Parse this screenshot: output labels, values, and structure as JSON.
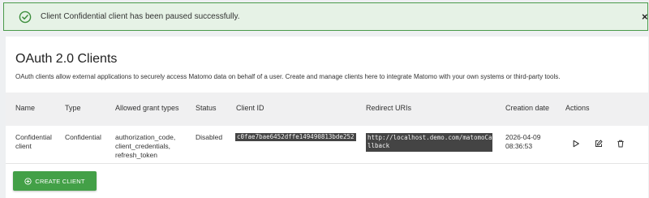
{
  "notice": {
    "message": "Client Confidential client has been paused successfully.",
    "close_glyph": "×",
    "icon": "check-circle-icon"
  },
  "card": {
    "title": "OAuth 2.0 Clients",
    "description": "OAuth clients allow external applications to securely access Matomo data on behalf of a user. Create and manage clients here to integrate Matomo with your own systems or third-party tools."
  },
  "table": {
    "headers": [
      "Name",
      "Type",
      "Allowed grant types",
      "Status",
      "Client ID",
      "Redirect URIs",
      "Creation date",
      "Actions"
    ],
    "rows": [
      {
        "name_line1": "Confidential",
        "name_line2": "client",
        "type": "Confidential",
        "grants": [
          "authorization_code,",
          "client_credentials,",
          "refresh_token"
        ],
        "status": "Disabled",
        "client_id": "c0fae7bae6452dffe149490813bde252",
        "redirect_line1": "http://localhost.demo.com/matomoCa",
        "redirect_line2": "llback",
        "date_line1": "2026-04-09",
        "date_line2": "08:36:53",
        "actions": [
          "play-icon",
          "edit-icon",
          "trash-icon"
        ]
      }
    ]
  },
  "create_button": {
    "label": "CREATE CLIENT",
    "icon": "plus-circle-icon"
  },
  "colors": {
    "notice_bg": "#e6f2e6",
    "notice_border": "#4a9a4a",
    "success_green": "#43a047",
    "code_bg": "#444444"
  }
}
